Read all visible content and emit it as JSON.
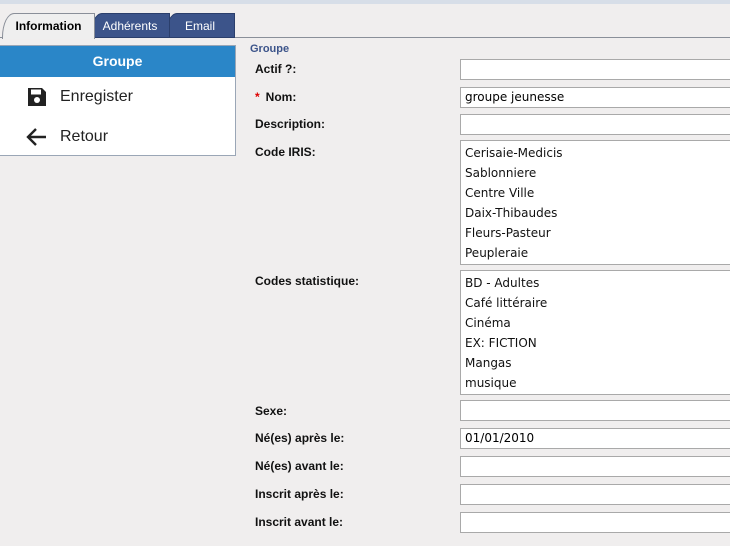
{
  "tabs": [
    {
      "label": "Information"
    },
    {
      "label": "Adhérents"
    },
    {
      "label": "Email"
    }
  ],
  "panel": {
    "header": "Groupe",
    "save_label": "Enregister",
    "back_label": "Retour"
  },
  "form": {
    "section_title": "Groupe",
    "required_mark": "*",
    "labels": {
      "actif": "Actif ?:",
      "nom": "Nom:",
      "description": "Description:",
      "code_iris": "Code IRIS:",
      "codes_statistique": "Codes statistique:",
      "sexe": "Sexe:",
      "nes_apres": "Né(es) après le:",
      "nes_avant": "Né(es) avant le:",
      "inscrit_apres": "Inscrit après le:",
      "inscrit_avant": "Inscrit avant le:"
    },
    "values": {
      "actif": "",
      "nom": "groupe jeunesse",
      "description": "",
      "sexe": "",
      "nes_apres": "01/01/2010",
      "nes_avant": "",
      "inscrit_apres": "",
      "inscrit_avant": ""
    },
    "code_iris_options": [
      "Cerisaie-Medicis",
      "Sablonniere",
      "Centre Ville",
      "Daix-Thibaudes",
      "Fleurs-Pasteur",
      "Peupleraie"
    ],
    "codes_statistique_options": [
      "BD - Adultes",
      "Café littéraire",
      "Cinéma",
      "EX: FICTION",
      "Mangas",
      "musique"
    ]
  }
}
